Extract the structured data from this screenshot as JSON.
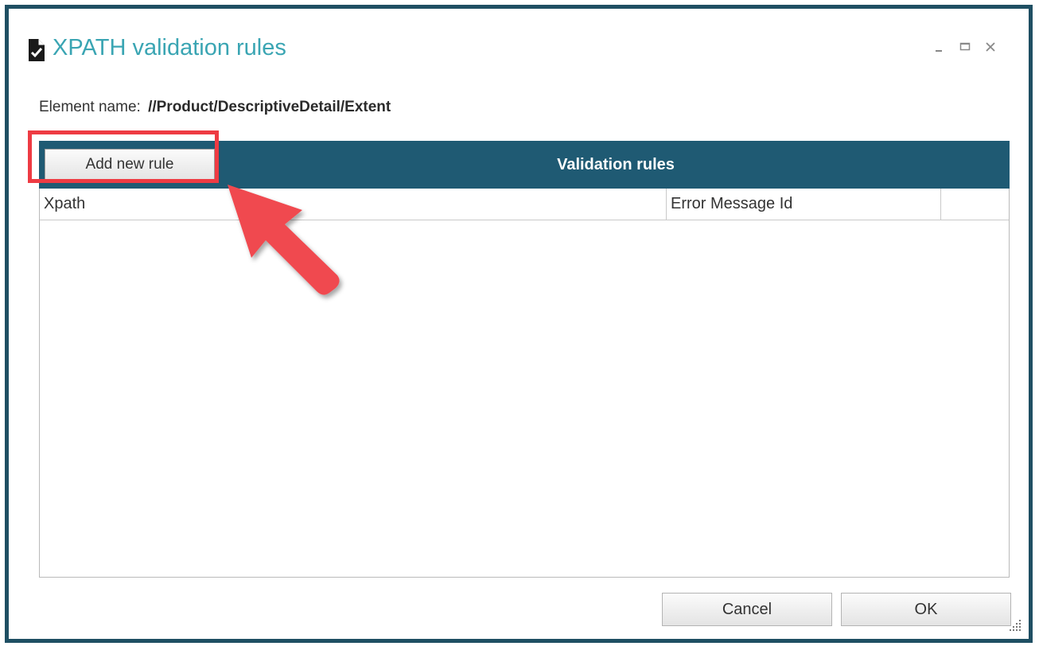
{
  "window": {
    "title": "XPATH validation rules",
    "title_color": "#3aa5b3",
    "border_color": "#1f4f63",
    "controls": [
      "minimize-icon",
      "maximize-icon",
      "close-icon"
    ]
  },
  "element": {
    "label": "Element name:",
    "value": "//Product/DescriptiveDetail/Extent"
  },
  "rules_panel": {
    "title": "Validation rules",
    "header_color": "#1f5a73",
    "add_button_label": "Add new rule",
    "columns": [
      "Xpath",
      "Error Message Id",
      ""
    ],
    "rows": []
  },
  "annotation": {
    "highlight_color": "#ee3b43",
    "arrow_icon": "red-pointer-arrow"
  },
  "footer": {
    "cancel_label": "Cancel",
    "ok_label": "OK"
  }
}
